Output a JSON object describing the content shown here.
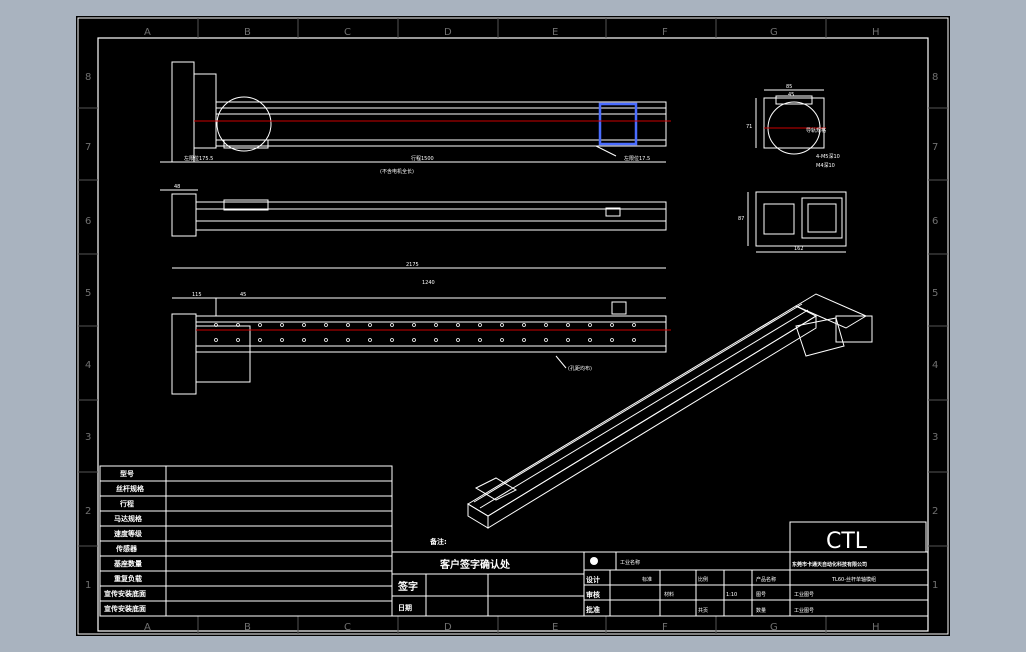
{
  "zones": {
    "columns": [
      "A",
      "B",
      "C",
      "D",
      "E",
      "F",
      "G",
      "H"
    ],
    "rows": [
      "8",
      "7",
      "6",
      "5",
      "4",
      "3",
      "2",
      "1"
    ]
  },
  "dimensions": {
    "top_left": "左限位175.5",
    "stroke": "行程1500",
    "total_length": "(不含电机全长)",
    "top_right": "左限位17.5",
    "side_left": "48",
    "plan_total": "2175",
    "plan_inner": "1240",
    "plan_left": "115",
    "plan_offset": "45",
    "holes_note": "(孔距均布)",
    "e_top": "85",
    "e_top2": "45",
    "e_height": "71",
    "e_label": "导轨规格",
    "e_note1": "4-M5深10",
    "e_note2": "M4深10",
    "e2_height": "87",
    "e2_width": "162"
  },
  "left_table": {
    "rows": [
      "型号",
      "丝杆规格",
      "行程",
      "马达规格",
      "速度等级",
      "传感器",
      "基座数量",
      "重复负载",
      "宣传安装底面",
      "宣传安装底面"
    ]
  },
  "client": {
    "remark_label": "备注:",
    "title": "客户签字确认处",
    "sign_label": "签字",
    "date_label": "日期"
  },
  "title_block": {
    "logo": "CTL",
    "company": "东莞市卡通天自动化科技有限公司",
    "drawing_name": "TL60-丝杆单轴模组",
    "symbol_label": "工业名称",
    "design_label": "设计",
    "check_label": "审核",
    "approve_label": "批准",
    "standard_label": "标准",
    "material_label": "材料",
    "scale_label": "比例",
    "scale_value": "1:10",
    "sheet_label": "共页",
    "product_label": "产品名称",
    "no_label": "图号",
    "qty_label": "数量",
    "drawing_no_label": "工业图号",
    "ref_label": "工业图号"
  },
  "colors": {
    "page": "#a9b3bf",
    "sheet": "#000000",
    "line": "#ffffff",
    "center": "#cc0000",
    "highlight": "#4a6cff"
  }
}
